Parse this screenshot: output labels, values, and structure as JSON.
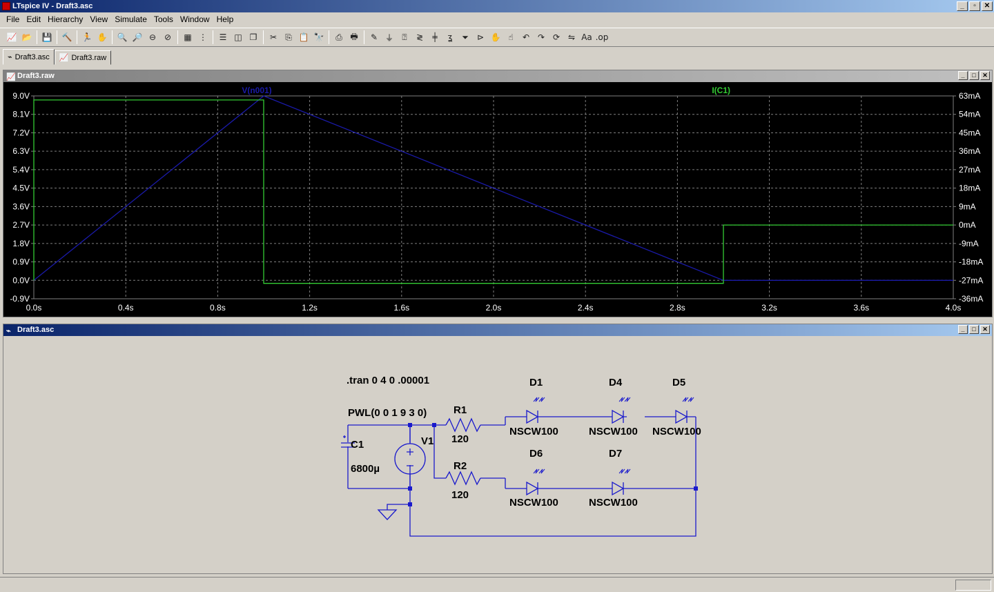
{
  "window": {
    "title": "LTspice IV - Draft3.asc",
    "min": "_",
    "restore": "▫",
    "close": "✕"
  },
  "menu": [
    "File",
    "Edit",
    "Hierarchy",
    "View",
    "Simulate",
    "Tools",
    "Window",
    "Help"
  ],
  "toolbar_icons": [
    "new-schematic",
    "open",
    "save",
    "control-panel",
    "run",
    "pause",
    "zoom-in",
    "pan",
    "zoom-out",
    "zoom-fit",
    "autorange",
    "grid",
    "tile-horizontal",
    "tile-vertical",
    "cascade",
    "cut",
    "copy",
    "paste",
    "find",
    "print-setup",
    "print",
    "wire",
    "ground",
    "label-net",
    "resistor",
    "capacitor",
    "inductor",
    "diode",
    "component",
    "move",
    "drag",
    "undo",
    "redo",
    "rotate",
    "mirror",
    "text",
    "spice-directive"
  ],
  "tabs": [
    {
      "label": "Draft3.asc",
      "icon": "schematic-icon"
    },
    {
      "label": "Draft3.raw",
      "icon": "waveform-icon"
    }
  ],
  "plot_window": {
    "title": "Draft3.raw"
  },
  "schematic_window": {
    "title": "Draft3.asc"
  },
  "chart_data": {
    "type": "line",
    "x_unit": "s",
    "xlim": [
      0,
      4.0
    ],
    "x_ticks": [
      "0.0s",
      "0.4s",
      "0.8s",
      "1.2s",
      "1.6s",
      "2.0s",
      "2.4s",
      "2.8s",
      "3.2s",
      "3.6s",
      "4.0s"
    ],
    "y_left_ticks": [
      "9.0V",
      "8.1V",
      "7.2V",
      "6.3V",
      "5.4V",
      "4.5V",
      "3.6V",
      "2.7V",
      "1.8V",
      "0.9V",
      "0.0V",
      "-0.9V"
    ],
    "y_right_ticks": [
      "63mA",
      "54mA",
      "45mA",
      "36mA",
      "27mA",
      "18mA",
      "9mA",
      "0mA",
      "-9mA",
      "-18mA",
      "-27mA",
      "-36mA"
    ],
    "ylim_left": [
      -0.9,
      9.0
    ],
    "ylim_right": [
      -36,
      63
    ],
    "grid": true,
    "series": [
      {
        "name": "V(n001)",
        "axis": "left",
        "color": "#1a1aa8",
        "x": [
          0,
          1,
          3,
          4
        ],
        "y": [
          0,
          9,
          0,
          0
        ]
      },
      {
        "name": "I(C1)",
        "axis": "right",
        "color": "#33cc33",
        "x": [
          0,
          0,
          1,
          1,
          3,
          3,
          4
        ],
        "y": [
          -27,
          61,
          61,
          -28.5,
          -28.5,
          0,
          0
        ]
      }
    ]
  },
  "schematic": {
    "directive": ".tran 0 4 0 .00001",
    "source_value": "PWL(0 0 1 9 3 0)",
    "source_ref": "V1",
    "capacitor": {
      "ref": "C1",
      "value": "6800µ"
    },
    "resistors": [
      {
        "ref": "R1",
        "value": "120"
      },
      {
        "ref": "R2",
        "value": "120"
      }
    ],
    "diodes": [
      {
        "ref": "D1",
        "model": "NSCW100"
      },
      {
        "ref": "D4",
        "model": "NSCW100"
      },
      {
        "ref": "D5",
        "model": "NSCW100"
      },
      {
        "ref": "D6",
        "model": "NSCW100"
      },
      {
        "ref": "D7",
        "model": "NSCW100"
      }
    ]
  }
}
